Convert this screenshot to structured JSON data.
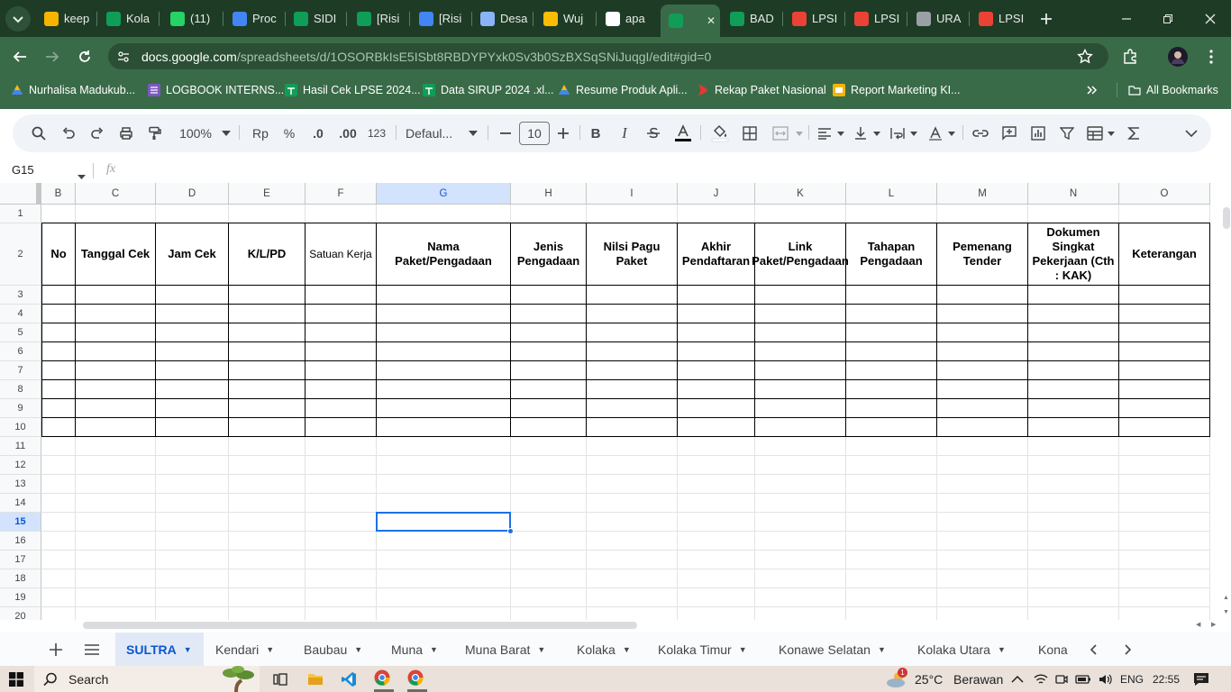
{
  "browser": {
    "tabs": [
      {
        "label": "keep",
        "color": "#f4b400"
      },
      {
        "label": "Kola",
        "color": "#0f9d58"
      },
      {
        "label": "(11)",
        "color": "#25d366"
      },
      {
        "label": "Proc",
        "color": "#4285f4"
      },
      {
        "label": "SIDI",
        "color": "#0f9d58"
      },
      {
        "label": "[Risi",
        "color": "#0f9d58"
      },
      {
        "label": "[Risi",
        "color": "#4285f4"
      },
      {
        "label": "Desa",
        "color": "#8ab4f8"
      },
      {
        "label": "Wuj",
        "color": "#fbbc04"
      },
      {
        "label": "apa",
        "color": "#ffffff"
      },
      {
        "label": "",
        "color": "#0f9d58"
      },
      {
        "label": "BAD",
        "color": "#0f9d58"
      },
      {
        "label": "LPSI",
        "color": "#ea4335"
      },
      {
        "label": "LPSI",
        "color": "#ea4335"
      },
      {
        "label": "URA",
        "color": "#9aa0a6"
      },
      {
        "label": "LPSI",
        "color": "#ea4335"
      }
    ],
    "url_host": "docs.google.com",
    "url_path": "/spreadsheets/d/1OSORBkIsE5ISbt8RBDYPYxk0Sv3b0SzBXSqSNiJuqgI/edit#gid=0",
    "bookmarks": [
      "Nurhalisa Madukub...",
      "LOGBOOK INTERNS...",
      "Hasil Cek LPSE 2024...",
      "Data SIRUP 2024 .xl...",
      "Resume Produk Apli...",
      "Rekap Paket Nasional",
      "Report Marketing KI..."
    ],
    "all_bookmarks": "All Bookmarks"
  },
  "sheets_toolbar": {
    "zoom": "100%",
    "currency": "Rp",
    "percent": "%",
    "dec_less": ".0",
    "dec_more": ".00",
    "number_format": "123",
    "font": "Defaul...",
    "font_size": "10"
  },
  "formula_bar": {
    "cell_ref": "G15",
    "fx": "fx"
  },
  "grid": {
    "columns": [
      "B",
      "C",
      "D",
      "E",
      "F",
      "G",
      "H",
      "I",
      "J",
      "K",
      "L",
      "M",
      "N",
      "O"
    ],
    "selected_column": "G",
    "rows": [
      "1",
      "2",
      "3",
      "4",
      "5",
      "6",
      "7",
      "8",
      "9",
      "10",
      "11",
      "12",
      "13",
      "14",
      "15",
      "16",
      "17",
      "18",
      "19",
      "20"
    ],
    "selected_row": "15",
    "headers": [
      "No",
      "Tanggal Cek",
      "Jam Cek",
      "K/L/PD",
      "Satuan Kerja",
      "Nama Paket/Pengadaan",
      "Jenis Pengadaan",
      "Nilsi Pagu Paket",
      "Akhir Pendaftaran",
      "Link Paket/Pengadaan",
      "Tahapan Pengadaan",
      "Pemenang Tender",
      "Dokumen Singkat Pekerjaan (Cth : KAK)",
      "Keterangan"
    ]
  },
  "sheet_tabs": {
    "tabs": [
      "SULTRA",
      "Kendari",
      "Baubau",
      "Muna",
      "Muna Barat",
      "Kolaka",
      "Kolaka Timur",
      "Konawe Selatan",
      "Kolaka Utara",
      "Konav"
    ],
    "active": "SULTRA"
  },
  "taskbar": {
    "search": "Search",
    "weather_temp": "25°C",
    "weather_desc": "Berawan",
    "weather_badge": "1",
    "lang": "ENG",
    "time": "22:55"
  }
}
